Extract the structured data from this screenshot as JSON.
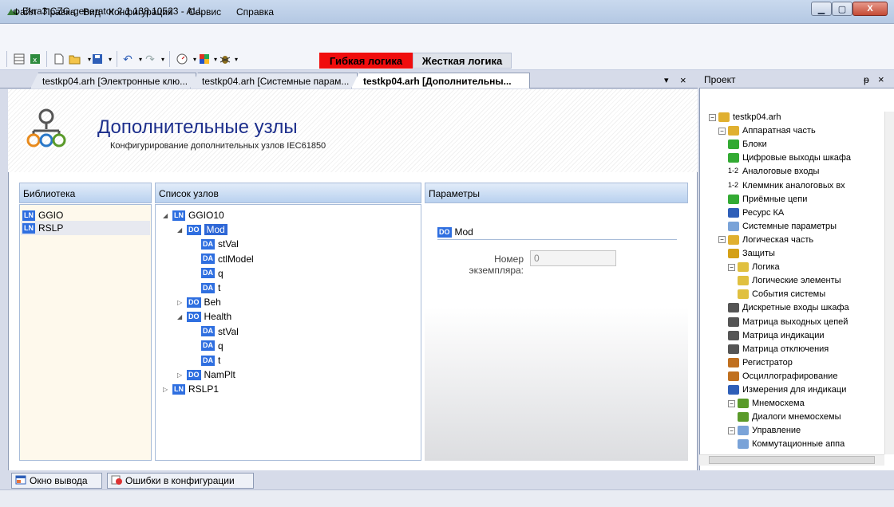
{
  "window": {
    "title": "Ekra3.CZG-generator 2.1.138.10523 - ALL"
  },
  "menu": [
    "Файл",
    "Правка",
    "Вид",
    "Конфигурация",
    "Сервис",
    "Справка"
  ],
  "toolbar": {
    "logic_flex": "Гибкая логика",
    "logic_hard": "Жесткая логика"
  },
  "tabs": [
    {
      "label": "testkp04.arh [Электронные клю..."
    },
    {
      "label": "testkp04.arh [Системные парам..."
    },
    {
      "label": "testkp04.arh [Дополнительны...",
      "active": true
    }
  ],
  "tab_controls": {
    "menu": "▾",
    "close": "×"
  },
  "page": {
    "title": "Дополнительные узлы",
    "subtitle": "Конфигурирование дополнительных узлов IEC61850"
  },
  "panels": {
    "library": "Библиотека",
    "nodes": "Список узлов",
    "params": "Параметры"
  },
  "library_items": [
    {
      "badge": "LN",
      "label": "GGIO"
    },
    {
      "badge": "LN",
      "label": "RSLP"
    }
  ],
  "tree": [
    {
      "badge": "LN",
      "label": "GGIO10",
      "expander": "◢"
    },
    {
      "badge": "DO",
      "label": "Mod",
      "expander": "◢",
      "selected": true
    },
    {
      "badge": "DA",
      "label": "stVal"
    },
    {
      "badge": "DA",
      "label": "ctlModel"
    },
    {
      "badge": "DA",
      "label": "q"
    },
    {
      "badge": "DA",
      "label": "t"
    },
    {
      "badge": "DO",
      "label": "Beh",
      "expander": "▷"
    },
    {
      "badge": "DO",
      "label": "Health",
      "expander": "◢"
    },
    {
      "badge": "DA",
      "label": "stVal"
    },
    {
      "badge": "DA",
      "label": "q"
    },
    {
      "badge": "DA",
      "label": "t"
    },
    {
      "badge": "DO",
      "label": "NamPlt",
      "expander": "▷"
    },
    {
      "badge": "LN",
      "label": "RSLP1",
      "expander": "▷"
    }
  ],
  "params": {
    "do_badge": "DO",
    "do_name": "Mod",
    "instance_label": "Номер экземпляра:",
    "instance_value": "0"
  },
  "project": {
    "title": "Проект",
    "pin": "ᵽ",
    "close": "×",
    "tree": [
      "testkp04.arh",
      "Аппаратная часть",
      "Блоки",
      "Цифровые выходы шкафа",
      "Аналоговые входы",
      "Клеммник аналоговых вх",
      "Приёмные цепи",
      "Ресурс КА",
      "Системные параметры",
      "Логическая часть",
      "Защиты",
      "Логика",
      "Логические элементы",
      "События системы",
      "Дискретные входы шкафа",
      "Матрица выходных цепей",
      "Матрица индикации",
      "Матрица отключения",
      "Регистратор",
      "Осциллографирование",
      "Измерения для индикаци",
      "Мнемосхема",
      "Диалоги мнемосхемы",
      "Управление",
      "Коммутационные аппа"
    ],
    "tree_prefix": [
      "",
      "",
      "",
      "",
      "1-2",
      "1-2",
      "",
      "",
      "",
      "",
      "",
      "",
      "",
      "",
      "",
      "",
      "",
      "",
      "",
      "",
      "",
      "",
      "",
      "",
      ""
    ]
  },
  "bottom_tabs": [
    "Окно вывода",
    "Ошибки в конфигурации"
  ],
  "colors": {
    "accent": "#2f6fe0",
    "flex_logic_bg": "#f00d0d",
    "title_blue": "#1d2f8c"
  }
}
